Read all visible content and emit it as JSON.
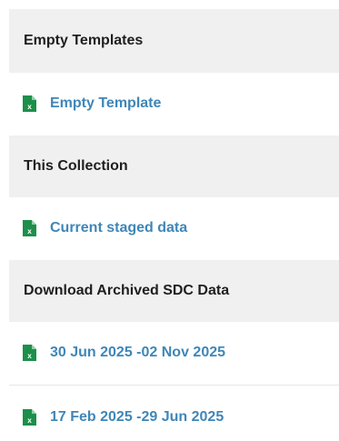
{
  "sections": [
    {
      "header": "Empty Templates",
      "items": [
        {
          "label": "Empty Template",
          "icon": "excel-file-icon"
        }
      ]
    },
    {
      "header": "This Collection",
      "items": [
        {
          "label": "Current staged data",
          "icon": "excel-file-icon"
        }
      ]
    },
    {
      "header": "Download Archived SDC Data",
      "items": [
        {
          "label": "30 Jun 2025 -02 Nov 2025",
          "icon": "excel-file-icon"
        },
        {
          "label": "17 Feb 2025 -29 Jun 2025",
          "icon": "excel-file-icon"
        }
      ]
    }
  ],
  "colors": {
    "header_bg": "#f0f0f0",
    "link": "#3f86b8",
    "excel_icon": "#1d8f4a",
    "header_text": "#1f1f1f"
  }
}
